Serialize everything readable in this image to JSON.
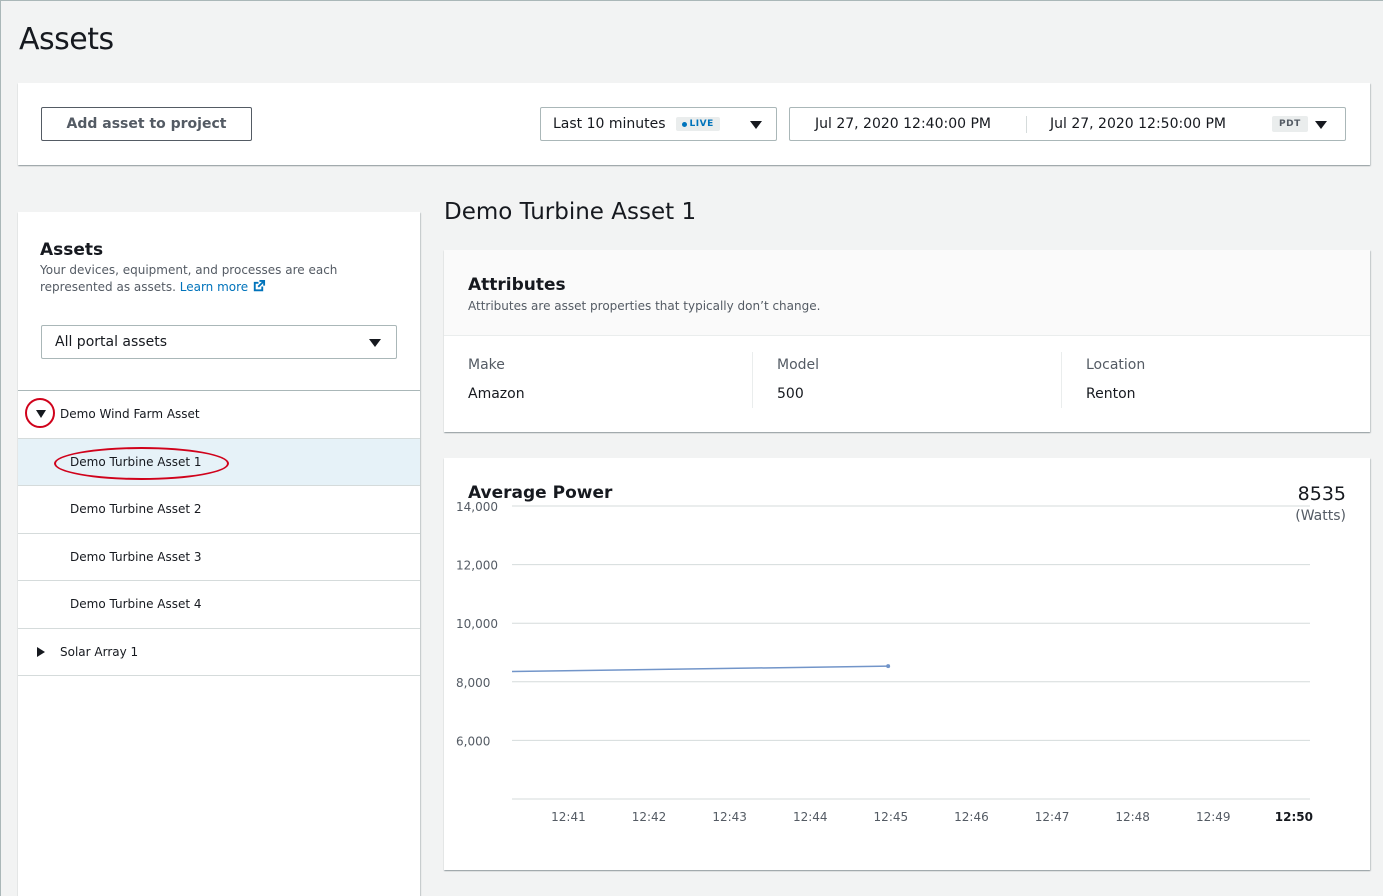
{
  "page": {
    "title": "Assets"
  },
  "toolbar": {
    "add_label": "Add asset to project",
    "range_label": "Last 10 minutes",
    "live_badge": "LIVE",
    "date_start": "Jul 27, 2020 12:40:00 PM",
    "date_end": "Jul 27, 2020 12:50:00 PM",
    "timezone": "PDT"
  },
  "sidebar": {
    "title": "Assets",
    "description": "Your devices, equipment, and processes are each represented as assets.",
    "learn_more": "Learn more",
    "filter_value": "All portal assets",
    "tree": [
      {
        "label": "Demo Wind Farm Asset",
        "expanded": true,
        "level": 0
      },
      {
        "label": "Demo Turbine Asset 1",
        "level": 1,
        "selected": true
      },
      {
        "label": "Demo Turbine Asset 2",
        "level": 1
      },
      {
        "label": "Demo Turbine Asset 3",
        "level": 1
      },
      {
        "label": "Demo Turbine Asset 4",
        "level": 1
      },
      {
        "label": "Solar Array 1",
        "expanded": false,
        "level": 0
      }
    ]
  },
  "asset": {
    "title": "Demo Turbine Asset 1",
    "attributes": {
      "title": "Attributes",
      "description": "Attributes are asset properties that typically don’t change.",
      "items": [
        {
          "key": "Make",
          "value": "Amazon"
        },
        {
          "key": "Model",
          "value": "500"
        },
        {
          "key": "Location",
          "value": "Renton"
        }
      ]
    },
    "chart": {
      "title": "Average Power",
      "latest_value": "8535",
      "unit": "(Watts)"
    }
  },
  "colors": {
    "accent": "#0073bb",
    "line": "#7295c9",
    "annotation": "#d0021b",
    "selected_bg": "#e6f2f8"
  },
  "chart_data": {
    "type": "line",
    "title": "Average Power",
    "ylim": [
      4000,
      14000
    ],
    "yticks": [
      14000,
      12000,
      10000,
      8000,
      6000
    ],
    "ytick_labels": [
      "14,000",
      "12,000",
      "10,000",
      "8,000",
      "6,000"
    ],
    "xlim_minutes": [
      40.3,
      50.2
    ],
    "xticks": [
      "12:41",
      "12:42",
      "12:43",
      "12:44",
      "12:45",
      "12:46",
      "12:47",
      "12:48",
      "12:49",
      "12:50"
    ],
    "xtick_values": [
      41,
      42,
      43,
      44,
      45,
      46,
      47,
      48,
      49,
      50
    ],
    "series": [
      {
        "x": [
          "12:40:18",
          "12:44:58"
        ],
        "y": [
          8350,
          8535
        ]
      }
    ],
    "grid": true
  }
}
